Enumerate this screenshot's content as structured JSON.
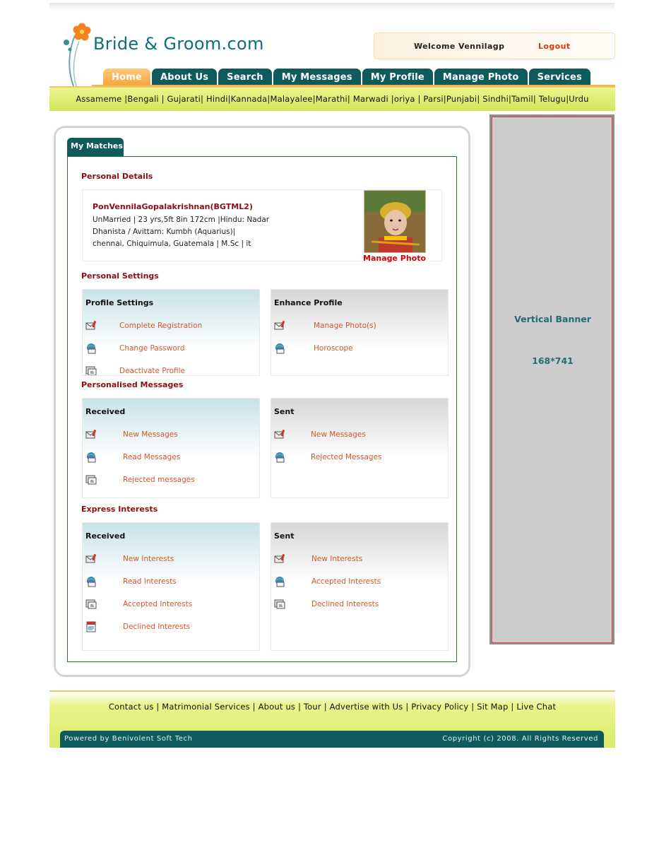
{
  "brand": {
    "name": "Bride & Groom.com"
  },
  "header": {
    "welcome": "Welcome Vennilagp",
    "logout": "Logout"
  },
  "nav": {
    "tabs": [
      "Home",
      "About Us",
      "Search",
      "My Messages",
      "My Profile",
      "Manage Photo",
      "Services"
    ],
    "active": "Home"
  },
  "languages": {
    "text": "Assameme |Bengali | Gujarati| Hindi|Kannada|Malayalee|Marathi| Marwadi |oriya | Parsi|Punjabi| Sindhi|Tamil| Telugu|Urdu"
  },
  "panel": {
    "tab": "My Matches"
  },
  "personal_details": {
    "title": "Personal Details",
    "name": "PonVennilaGopalakrishnan(BGTML2)",
    "line1": "UnMarried | 23 yrs,5ft 8in 172cm |Hindu: Nadar",
    "line2": "Dhanista / Avittam: Kumbh (Aquarius)|",
    "line3": "chennai, Chiquimula, Guatemala | M.Sc | it",
    "manage_photo": "Manage Photo"
  },
  "personal_settings": {
    "title": "Personal Settings",
    "profile_settings": {
      "title": "Profile Settings",
      "items": [
        "Complete Registration",
        "Change Password",
        "Deactivate Profile"
      ]
    },
    "enhance_profile": {
      "title": "Enhance Profile",
      "items": [
        "Manage Photo(s)",
        "Horoscope"
      ]
    }
  },
  "personalised_messages": {
    "title": "Personalised Messages",
    "received": {
      "title": "Received",
      "items": [
        "New Messages",
        "Read Messages",
        "Rejected messages"
      ]
    },
    "sent": {
      "title": "Sent",
      "items": [
        "New Messages",
        "Rejected Messages"
      ]
    }
  },
  "express_interests": {
    "title": "Express Interests",
    "received": {
      "title": "Received",
      "items": [
        "New Interests",
        "Read Interests",
        "Accepted Interests",
        "Declined Interests"
      ]
    },
    "sent": {
      "title": "Sent",
      "items": [
        "New Interests",
        "Accepted Interests",
        "Declined Interests"
      ]
    }
  },
  "banner": {
    "label": "Vertical Banner",
    "size": "168*741"
  },
  "footer": {
    "links": "Contact us | Matrimonial Services | About us | Tour | Advertise with Us | Privacy Policy | Sit Map | Live Chat",
    "powered": "Powered by Benivolent Soft Tech",
    "copyright": "Copyright (c) 2008. All Rights Reserved"
  },
  "colors": {
    "teal": "#0e5a5c",
    "maroon": "#8b0d16",
    "link_orange": "#d4582d",
    "lime": "#d8ea66",
    "tab_orange": "#f6a43a"
  },
  "icons": {
    "row1": "envelope-pen-icon",
    "row2": "globe-envelope-icon",
    "row3": "reply-window-icon",
    "row4": "document-icon"
  }
}
